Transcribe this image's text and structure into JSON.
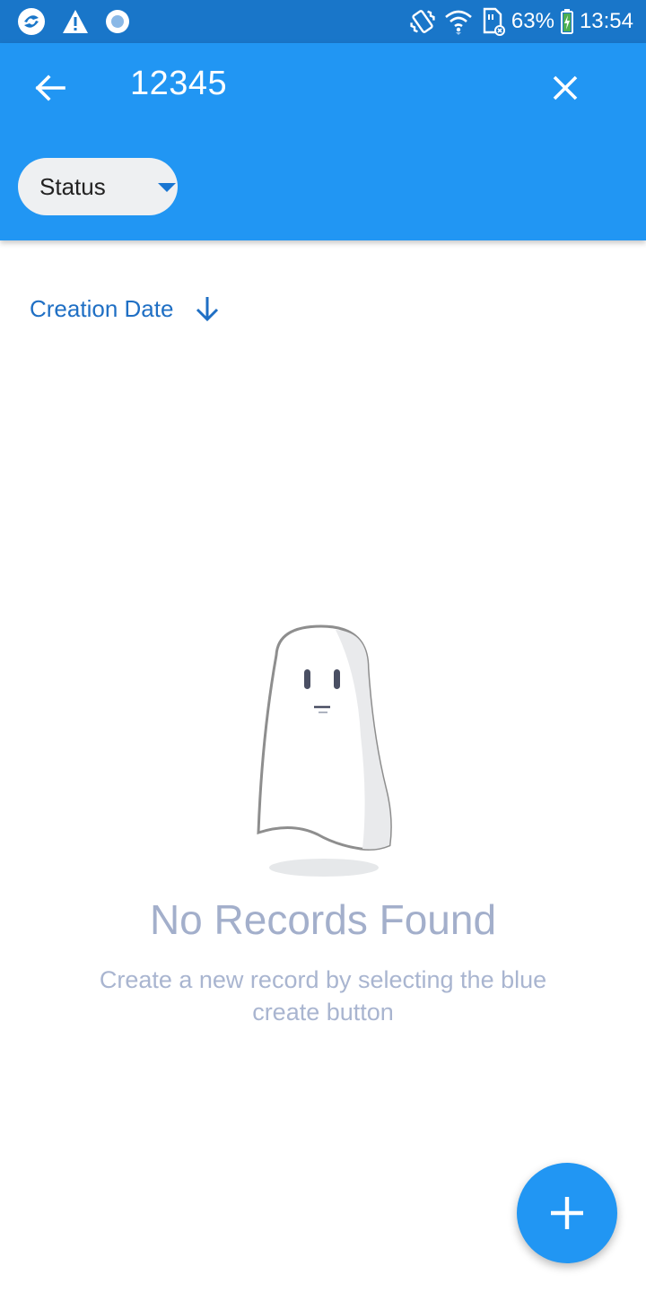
{
  "status_bar": {
    "battery": "63%",
    "time": "13:54",
    "icons": [
      "app-logo-icon",
      "warning-icon",
      "record-icon",
      "vibrate-icon",
      "wifi-icon",
      "sim-card-icon",
      "battery-charging-icon"
    ]
  },
  "app_bar": {
    "search_query": "12345",
    "back_icon": "arrow-back-icon",
    "close_icon": "close-icon",
    "filter_chip": {
      "label": "Status",
      "icon": "dropdown-caret-icon"
    }
  },
  "sort": {
    "label": "Creation Date",
    "direction_icon": "arrow-down-icon"
  },
  "empty_state": {
    "illustration": "ghost-illustration",
    "title": "No Records Found",
    "subtitle": "Create a new record by selecting the blue create button"
  },
  "fab": {
    "icon": "plus-icon"
  },
  "colors": {
    "status_bar": "#1976c9",
    "app_bar": "#2196f3",
    "accent": "#1f6fc4",
    "empty_text": "#a3afcb"
  }
}
